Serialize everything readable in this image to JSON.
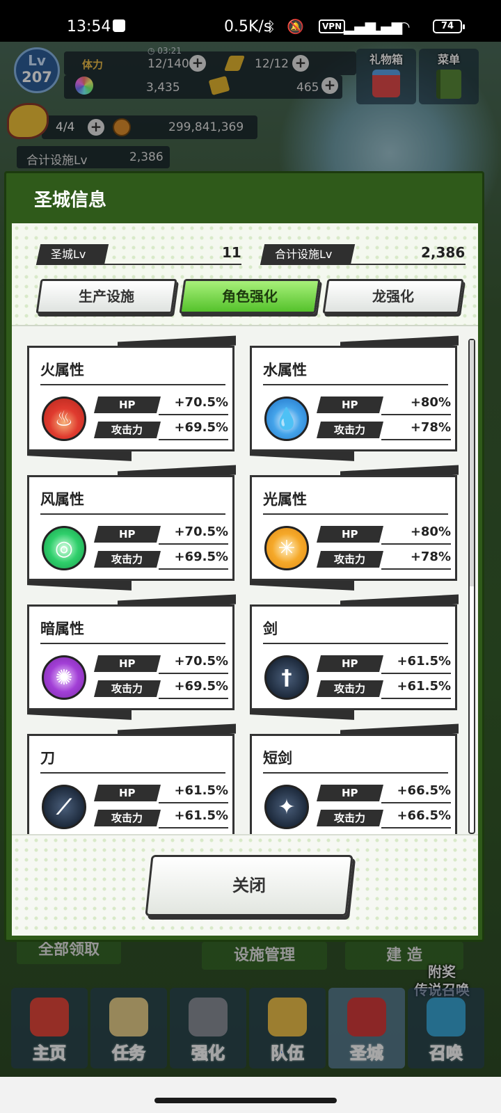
{
  "statusbar": {
    "time": "13:54",
    "net_speed": "0.5K/s",
    "vpn": "VPN",
    "battery": "74"
  },
  "hud": {
    "level_label": "Lv",
    "level": "207",
    "stamina_label": "体力",
    "stamina_timer": "03:21",
    "stamina_value": "12/140",
    "feather_value": "12/12",
    "gem_value": "3,435",
    "ticket_value": "465",
    "dragon_value": "4/4",
    "coin_value": "299,841,369",
    "total_facility_label": "合计设施Lv",
    "total_facility_value": "2,386",
    "gift_label": "礼物箱",
    "menu_label": "菜单"
  },
  "modal": {
    "title": "圣城信息",
    "castle_lv_label": "圣城Lv",
    "castle_lv_value": "11",
    "total_lv_label": "合计设施Lv",
    "total_lv_value": "2,386",
    "tabs": [
      {
        "label": "生产设施",
        "active": false
      },
      {
        "label": "角色强化",
        "active": true
      },
      {
        "label": "龙强化",
        "active": false
      }
    ],
    "hp_label": "HP",
    "atk_label": "攻击力",
    "cards": [
      {
        "title": "火属性",
        "icon": "fire-icon",
        "hp": "+70.5%",
        "atk": "+69.5%"
      },
      {
        "title": "水属性",
        "icon": "water-icon",
        "hp": "+80%",
        "atk": "+78%"
      },
      {
        "title": "风属性",
        "icon": "wind-icon",
        "hp": "+70.5%",
        "atk": "+69.5%"
      },
      {
        "title": "光属性",
        "icon": "light-icon",
        "hp": "+80%",
        "atk": "+78%"
      },
      {
        "title": "暗属性",
        "icon": "dark-icon",
        "hp": "+70.5%",
        "atk": "+69.5%"
      },
      {
        "title": "剑",
        "icon": "sword-icon",
        "hp": "+61.5%",
        "atk": "+61.5%"
      },
      {
        "title": "刀",
        "icon": "blade-icon",
        "hp": "+61.5%",
        "atk": "+61.5%"
      },
      {
        "title": "短剑",
        "icon": "dagger-icon",
        "hp": "+66.5%",
        "atk": "+66.5%"
      }
    ],
    "close_label": "关闭",
    "scroll_fraction": 0.5
  },
  "background_buttons": {
    "claim_all": "全部领取",
    "facility_manage": "设施管理",
    "build": "建 造",
    "bonus_line1": "附奖",
    "bonus_line2": "传说召唤"
  },
  "nav": [
    {
      "label": "主页",
      "color": "#2e6de0"
    },
    {
      "label": "任务",
      "color": "#c02fd6"
    },
    {
      "label": "强化",
      "color": "#2e6de0"
    },
    {
      "label": "队伍",
      "color": "#2e6de0"
    },
    {
      "label": "圣城",
      "color": "#2e6de0"
    },
    {
      "label": "召唤",
      "color": "#2e6de0"
    }
  ]
}
